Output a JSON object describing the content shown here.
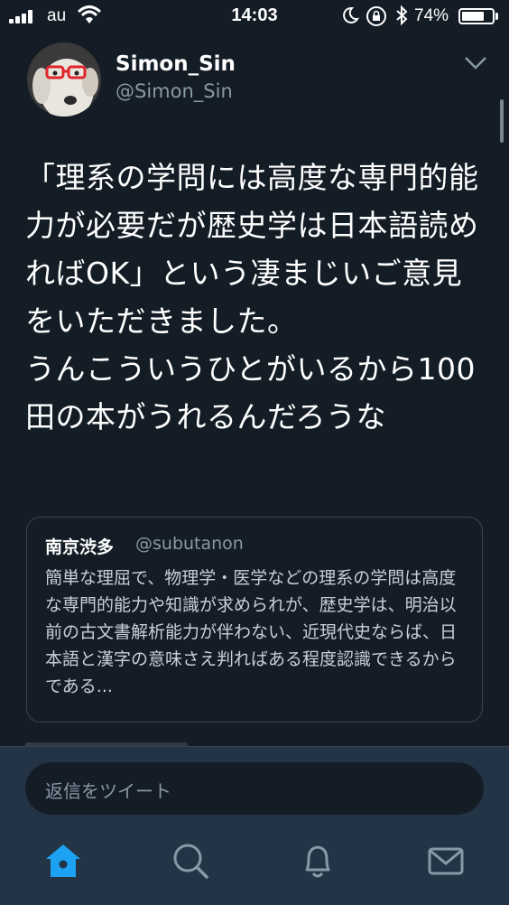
{
  "status_bar": {
    "carrier": "au",
    "time": "14:03",
    "battery_percent": "74%",
    "battery_level": 0.74
  },
  "tweet": {
    "author_name": "Simon_Sin",
    "author_handle": "@Simon_Sin",
    "text": "「理系の学問には高度な専門的能力が必要だが歴史学は日本語読めればOK」という凄まじいご意見をいただきました。\nうんこういうひとがいるから100田の本がうれるんだろうな"
  },
  "quoted_tweet": {
    "author_name": "南京渋多",
    "author_handle": "@subutanon",
    "text": "簡単な理屈で、物理学・医学などの理系の学問は高度な専門的能力や知識が求められが、歴史学は、明治以前の古文書解析能力が伴わない、近現代史ならば、日本語と漢字の意味さえ判ればある程度認識できるからである..."
  },
  "reply": {
    "placeholder": "返信をツイート"
  },
  "tabs": [
    {
      "icon": "home-icon",
      "active": true
    },
    {
      "icon": "search-icon",
      "active": false
    },
    {
      "icon": "bell-icon",
      "active": false
    },
    {
      "icon": "mail-icon",
      "active": false
    }
  ],
  "colors": {
    "background": "#141d26",
    "accent": "#1da1f2",
    "secondary_text": "#8899a6",
    "bottom_bar": "#243447"
  }
}
